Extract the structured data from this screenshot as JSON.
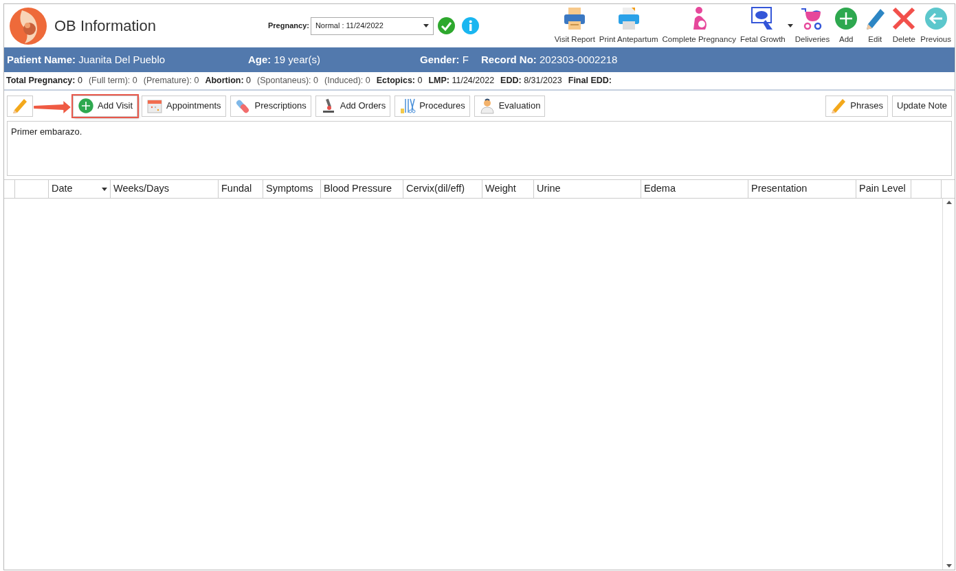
{
  "app": {
    "title": "OB Information"
  },
  "pregnancy": {
    "label": "Pregnancy:",
    "value": "Normal : 11/24/2022"
  },
  "toolbar": [
    {
      "kind": "visit-report",
      "label": "Visit Report"
    },
    {
      "kind": "print",
      "label": "Print Antepartum"
    },
    {
      "kind": "pregnant",
      "label": "Complete Pregnancy"
    },
    {
      "kind": "ultrasound",
      "label": "Fetal Growth",
      "dropdown": true
    },
    {
      "kind": "stroller",
      "label": "Deliveries"
    },
    {
      "kind": "add",
      "label": "Add"
    },
    {
      "kind": "edit",
      "label": "Edit"
    },
    {
      "kind": "delete",
      "label": "Delete"
    },
    {
      "kind": "previous",
      "label": "Previous"
    }
  ],
  "patient_bar": [
    {
      "label": "Patient Name:",
      "value": "Juanita Del Pueblo"
    },
    {
      "label": "Age:",
      "value": "19 year(s)"
    },
    {
      "label": "Gender:",
      "value": "F"
    },
    {
      "label": "Record No:",
      "value": "202303-0002218"
    }
  ],
  "stats": [
    {
      "label": "Total Pregnancy:",
      "value": "0",
      "bold": true
    },
    {
      "label": "(Full term):",
      "value": "0",
      "bold": false
    },
    {
      "label": "(Premature):",
      "value": "0",
      "bold": false
    },
    {
      "label": "Abortion:",
      "value": "0",
      "bold": true
    },
    {
      "label": "(Spontaneus):",
      "value": "0",
      "bold": false
    },
    {
      "label": "(Induced):",
      "value": "0",
      "bold": false
    },
    {
      "label": "Ectopics:",
      "value": "0",
      "bold": true
    },
    {
      "label": "LMP:",
      "value": "11/24/2022",
      "bold": true
    },
    {
      "label": "EDD:",
      "value": "8/31/2023",
      "bold": true
    },
    {
      "label": "Final EDD:",
      "bold": true
    }
  ],
  "actions_left": [
    {
      "kind": "edit-visit",
      "callout": false
    },
    {
      "kind": "add",
      "label": "Add Visit",
      "callout": true
    },
    {
      "kind": "calendar",
      "label": "Appointments",
      "callout": false
    },
    {
      "kind": "pills",
      "label": "Prescriptions",
      "callout": false
    },
    {
      "kind": "microscope",
      "label": "Add Orders",
      "callout": false
    },
    {
      "kind": "tools",
      "label": "Procedures",
      "callout": false
    },
    {
      "kind": "doctor",
      "label": "Evaluation",
      "callout": false
    }
  ],
  "actions_right": [
    {
      "kind": "pencil",
      "label": "Phrases"
    },
    {
      "kind": "none",
      "label": "Update Note"
    }
  ],
  "note": {
    "value": "Primer embarazo."
  },
  "grid": {
    "columns": [
      {
        "label": "Date",
        "menu": true
      },
      {
        "label": "Weeks/Days",
        "menu": false
      },
      {
        "label": "Fundal",
        "menu": false
      },
      {
        "label": "Symptoms",
        "menu": false
      },
      {
        "label": "Blood Pressure",
        "menu": false
      },
      {
        "label": "Cervix(dil/eff)",
        "menu": false
      },
      {
        "label": "Weight",
        "menu": false
      },
      {
        "label": "Urine",
        "menu": false
      },
      {
        "label": "Edema",
        "menu": false
      },
      {
        "label": "Presentation",
        "menu": false
      },
      {
        "label": "Pain Level",
        "menu": false
      }
    ]
  }
}
